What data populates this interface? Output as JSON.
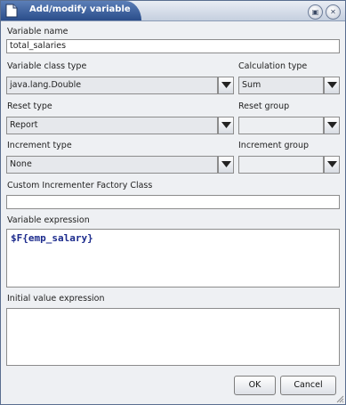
{
  "window": {
    "title": "Add/modify variable"
  },
  "fields": {
    "variable_name": {
      "label": "Variable name",
      "value": "total_salaries"
    },
    "variable_class": {
      "label": "Variable class type",
      "value": "java.lang.Double"
    },
    "calculation": {
      "label": "Calculation type",
      "value": "Sum"
    },
    "reset_type": {
      "label": "Reset type",
      "value": "Report"
    },
    "reset_group": {
      "label": "Reset group",
      "value": ""
    },
    "increment_type": {
      "label": "Increment type",
      "value": "None"
    },
    "increment_group": {
      "label": "Increment group",
      "value": ""
    },
    "custom_factory": {
      "label": "Custom Incrementer Factory Class",
      "value": ""
    },
    "variable_expression": {
      "label": "Variable expression",
      "value": "$F{emp_salary}"
    },
    "initial_value": {
      "label": "Initial value expression",
      "value": ""
    }
  },
  "buttons": {
    "ok": "OK",
    "cancel": "Cancel"
  },
  "icons": {
    "window": "window-doc-icon",
    "minimize": "minimize-icon",
    "close": "close-icon",
    "dropdown": "chevron-down-icon"
  }
}
